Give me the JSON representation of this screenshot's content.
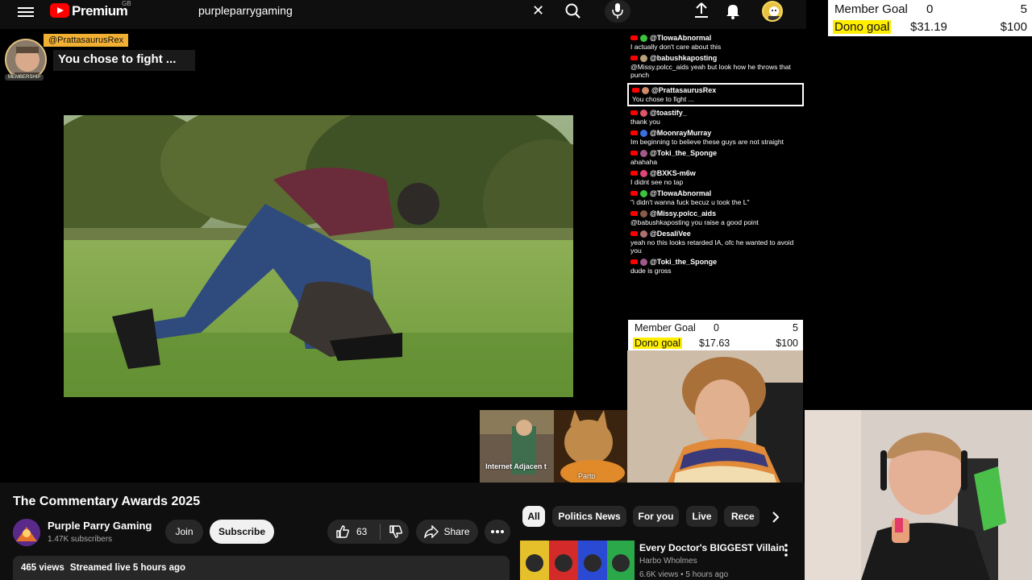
{
  "topbar": {
    "brand": "Premium",
    "region": "GB",
    "search_value": "purpleparrygaming"
  },
  "overlay_goal_main": {
    "member_label": "Member Goal",
    "member_current": "0",
    "member_target": "5",
    "dono_label": "Dono goal",
    "dono_current": "$31.19",
    "dono_target": "$100"
  },
  "overlay_goal_stream": {
    "member_label": "Member Goal",
    "member_current": "0",
    "member_target": "5",
    "dono_label": "Dono goal",
    "dono_current": "$17.63",
    "dono_target": "$100"
  },
  "super_chat": {
    "name": "@PrattasaurusRex",
    "text": "You chose to fight ...",
    "badge": "MEMBERSHIP"
  },
  "chat": [
    {
      "name": "@TIowaAbnormal",
      "text": "I actually don't care about this",
      "color": "#3cc43c"
    },
    {
      "name": "@babushkaposting",
      "text": "@Missy.polcc_aids yeah but look how he throws that punch",
      "color": "#b9a07a"
    },
    {
      "name": "@PrattasaurusRex",
      "text": "You chose to fight ...",
      "color": "#d08a6a",
      "highlight": true
    },
    {
      "name": "@toastify_",
      "text": "thank you",
      "color": "#e0556a"
    },
    {
      "name": "@MoonrayMurray",
      "text": "Im beginning to believe these guys are not straight",
      "color": "#3b6fe0"
    },
    {
      "name": "@Toki_the_Sponge",
      "text": "ahahaha",
      "color": "#a05a8a"
    },
    {
      "name": "@BXKS-m6w",
      "text": "I didnt see no tap",
      "color": "#e0457a"
    },
    {
      "name": "@TIowaAbnormal",
      "text": "\"i didn't wanna fuck becuz u took the L\"",
      "color": "#3cc43c"
    },
    {
      "name": "@Missy.polcc_aids",
      "text": "@babushkaposting you raise a good point",
      "color": "#8a5a4a"
    },
    {
      "name": "@DesaliVee",
      "text": "yeah no this looks retarded IA, ofc he wanted to avoid you",
      "color": "#b07070"
    },
    {
      "name": "@Toki_the_Sponge",
      "text": "dude is gross",
      "color": "#a05a8a"
    }
  ],
  "cat_clip": {
    "left_caption": "Internet Adjacen t",
    "right_caption": "Parto"
  },
  "video": {
    "title": "The Commentary Awards 2025",
    "channel": "Purple Parry Gaming",
    "subscribers": "1.47K subscribers",
    "join_label": "Join",
    "subscribe_label": "Subscribe",
    "likes": "63",
    "share_label": "Share",
    "views": "465 views",
    "streamed": "Streamed live 5 hours ago"
  },
  "chips": [
    "All",
    "Politics News",
    "For you",
    "Live",
    "Rece"
  ],
  "recommendation": {
    "title": "Every Doctor's BIGGEST Villain",
    "channel": "Harbo Wholmes",
    "meta": "6.6K views • 5 hours ago"
  },
  "icons": {
    "menu": "hamburger-icon",
    "search": "search-icon",
    "clear": "close-icon",
    "mic": "mic-icon",
    "upload": "upload-icon",
    "notifications": "bell-icon",
    "like": "thumbs-up-icon",
    "dislike": "thumbs-down-icon",
    "share": "share-icon",
    "more": "more-vert-icon",
    "next": "chevron-right-icon"
  },
  "colors": {
    "youtube_red": "#ff0000",
    "goal_highlight": "#ffee00",
    "super_chat_gold": "#f2b033"
  }
}
